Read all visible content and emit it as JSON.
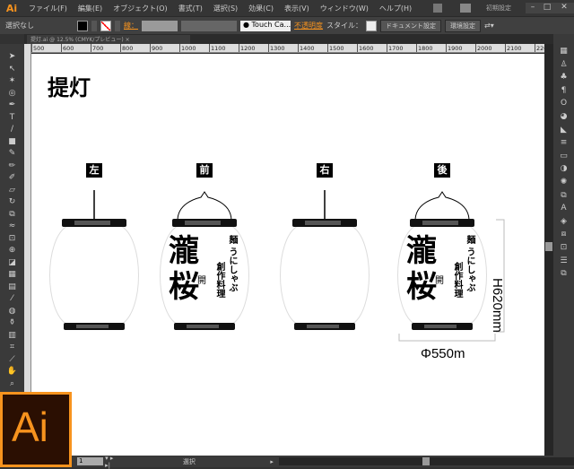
{
  "app": {
    "logo": "Ai",
    "workspace": "初期設定",
    "window_controls": [
      "minimize",
      "maximize",
      "close"
    ]
  },
  "menu": [
    "ファイル(F)",
    "編集(E)",
    "オブジェクト(O)",
    "書式(T)",
    "選択(S)",
    "効果(C)",
    "表示(V)",
    "ウィンドウ(W)",
    "ヘルプ(H)"
  ],
  "control": {
    "selection": "選択なし",
    "stroke_label": "線：",
    "font": "Touch Ca...",
    "opacity_label": "不透明度",
    "style_label": "スタイル：",
    "document_setup": "ドキュメント設定",
    "preferences": "環境設定"
  },
  "document_tab": {
    "title": "提灯.ai @ 12.5% (CMYK/プレビュー)",
    "close": "×"
  },
  "ruler": [
    "500",
    "600",
    "700",
    "800",
    "900",
    "1000",
    "1100",
    "1200",
    "1300",
    "1400",
    "1500",
    "1600",
    "1700",
    "1800",
    "1900",
    "2000",
    "2100",
    "2200",
    "2300",
    "2400",
    "2500",
    "2600",
    "2700",
    "2800",
    "2900",
    "3000",
    "3100",
    "3200",
    "330"
  ],
  "artboard": {
    "title": "提灯",
    "views": [
      {
        "label": "左",
        "design": false,
        "hook": "rod"
      },
      {
        "label": "前",
        "design": true,
        "hook": "bail"
      },
      {
        "label": "右",
        "design": false,
        "hook": "rod"
      },
      {
        "label": "後",
        "design": true,
        "hook": "bail"
      }
    ],
    "lantern_text": {
      "main": "瀧桜",
      "small": "開",
      "line1": "麺 うにしゃぶ",
      "line2": "創作料理"
    },
    "height_dim": "H620mm",
    "diameter_dim": "Φ550m"
  },
  "status": {
    "page": "1",
    "tool": "選択"
  },
  "colors": {
    "accent": "#f7931e",
    "ui_bg": "#323232",
    "canvas": "#ffffff"
  }
}
